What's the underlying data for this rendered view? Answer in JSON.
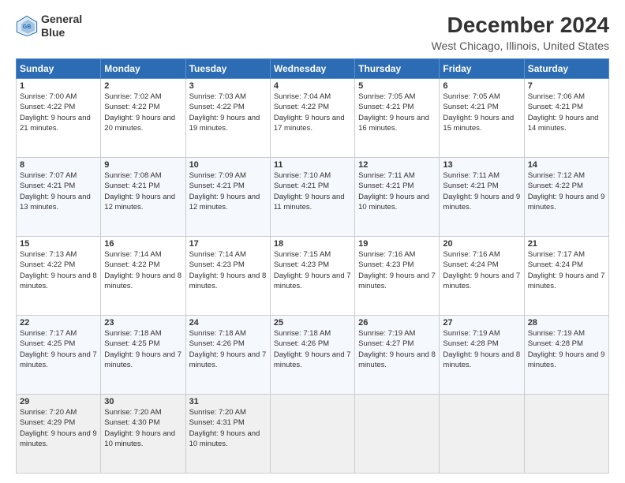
{
  "logo": {
    "line1": "General",
    "line2": "Blue"
  },
  "title": "December 2024",
  "subtitle": "West Chicago, Illinois, United States",
  "days_header": [
    "Sunday",
    "Monday",
    "Tuesday",
    "Wednesday",
    "Thursday",
    "Friday",
    "Saturday"
  ],
  "weeks": [
    [
      {
        "day": "1",
        "sunrise": "7:00 AM",
        "sunset": "4:22 PM",
        "daylight": "9 hours and 21 minutes."
      },
      {
        "day": "2",
        "sunrise": "7:02 AM",
        "sunset": "4:22 PM",
        "daylight": "9 hours and 20 minutes."
      },
      {
        "day": "3",
        "sunrise": "7:03 AM",
        "sunset": "4:22 PM",
        "daylight": "9 hours and 19 minutes."
      },
      {
        "day": "4",
        "sunrise": "7:04 AM",
        "sunset": "4:22 PM",
        "daylight": "9 hours and 17 minutes."
      },
      {
        "day": "5",
        "sunrise": "7:05 AM",
        "sunset": "4:21 PM",
        "daylight": "9 hours and 16 minutes."
      },
      {
        "day": "6",
        "sunrise": "7:05 AM",
        "sunset": "4:21 PM",
        "daylight": "9 hours and 15 minutes."
      },
      {
        "day": "7",
        "sunrise": "7:06 AM",
        "sunset": "4:21 PM",
        "daylight": "9 hours and 14 minutes."
      }
    ],
    [
      {
        "day": "8",
        "sunrise": "7:07 AM",
        "sunset": "4:21 PM",
        "daylight": "9 hours and 13 minutes."
      },
      {
        "day": "9",
        "sunrise": "7:08 AM",
        "sunset": "4:21 PM",
        "daylight": "9 hours and 12 minutes."
      },
      {
        "day": "10",
        "sunrise": "7:09 AM",
        "sunset": "4:21 PM",
        "daylight": "9 hours and 12 minutes."
      },
      {
        "day": "11",
        "sunrise": "7:10 AM",
        "sunset": "4:21 PM",
        "daylight": "9 hours and 11 minutes."
      },
      {
        "day": "12",
        "sunrise": "7:11 AM",
        "sunset": "4:21 PM",
        "daylight": "9 hours and 10 minutes."
      },
      {
        "day": "13",
        "sunrise": "7:11 AM",
        "sunset": "4:21 PM",
        "daylight": "9 hours and 9 minutes."
      },
      {
        "day": "14",
        "sunrise": "7:12 AM",
        "sunset": "4:22 PM",
        "daylight": "9 hours and 9 minutes."
      }
    ],
    [
      {
        "day": "15",
        "sunrise": "7:13 AM",
        "sunset": "4:22 PM",
        "daylight": "9 hours and 8 minutes."
      },
      {
        "day": "16",
        "sunrise": "7:14 AM",
        "sunset": "4:22 PM",
        "daylight": "9 hours and 8 minutes."
      },
      {
        "day": "17",
        "sunrise": "7:14 AM",
        "sunset": "4:23 PM",
        "daylight": "9 hours and 8 minutes."
      },
      {
        "day": "18",
        "sunrise": "7:15 AM",
        "sunset": "4:23 PM",
        "daylight": "9 hours and 7 minutes."
      },
      {
        "day": "19",
        "sunrise": "7:16 AM",
        "sunset": "4:23 PM",
        "daylight": "9 hours and 7 minutes."
      },
      {
        "day": "20",
        "sunrise": "7:16 AM",
        "sunset": "4:24 PM",
        "daylight": "9 hours and 7 minutes."
      },
      {
        "day": "21",
        "sunrise": "7:17 AM",
        "sunset": "4:24 PM",
        "daylight": "9 hours and 7 minutes."
      }
    ],
    [
      {
        "day": "22",
        "sunrise": "7:17 AM",
        "sunset": "4:25 PM",
        "daylight": "9 hours and 7 minutes."
      },
      {
        "day": "23",
        "sunrise": "7:18 AM",
        "sunset": "4:25 PM",
        "daylight": "9 hours and 7 minutes."
      },
      {
        "day": "24",
        "sunrise": "7:18 AM",
        "sunset": "4:26 PM",
        "daylight": "9 hours and 7 minutes."
      },
      {
        "day": "25",
        "sunrise": "7:18 AM",
        "sunset": "4:26 PM",
        "daylight": "9 hours and 7 minutes."
      },
      {
        "day": "26",
        "sunrise": "7:19 AM",
        "sunset": "4:27 PM",
        "daylight": "9 hours and 8 minutes."
      },
      {
        "day": "27",
        "sunrise": "7:19 AM",
        "sunset": "4:28 PM",
        "daylight": "9 hours and 8 minutes."
      },
      {
        "day": "28",
        "sunrise": "7:19 AM",
        "sunset": "4:28 PM",
        "daylight": "9 hours and 9 minutes."
      }
    ],
    [
      {
        "day": "29",
        "sunrise": "7:20 AM",
        "sunset": "4:29 PM",
        "daylight": "9 hours and 9 minutes."
      },
      {
        "day": "30",
        "sunrise": "7:20 AM",
        "sunset": "4:30 PM",
        "daylight": "9 hours and 10 minutes."
      },
      {
        "day": "31",
        "sunrise": "7:20 AM",
        "sunset": "4:31 PM",
        "daylight": "9 hours and 10 minutes."
      },
      null,
      null,
      null,
      null
    ]
  ]
}
